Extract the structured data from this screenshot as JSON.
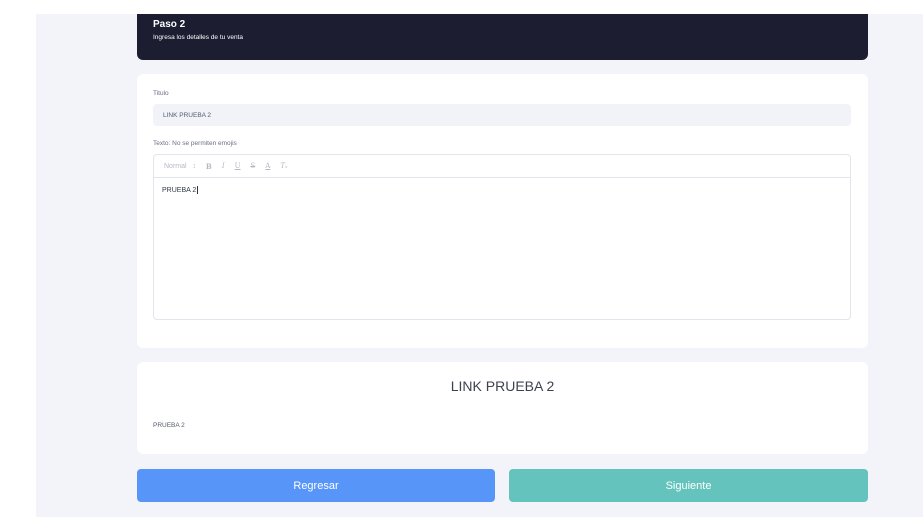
{
  "header": {
    "step": "Paso 2",
    "subtitle": "Ingresa los detalles de tu venta"
  },
  "form": {
    "title_label": "Titulo",
    "title_value": "LINK PRUEBA 2",
    "text_label": "Texto: No se permiten emojis",
    "toolbar": {
      "format": "Normal",
      "format_arrow": "↕",
      "bold": "B",
      "italic": "I",
      "underline": "U",
      "strike": "S",
      "color": "A",
      "clear": "Tₓ"
    },
    "editor_text": "PRUEBA 2"
  },
  "preview": {
    "title": "LINK PRUEBA 2",
    "body": "PRUEBA 2"
  },
  "buttons": {
    "back": "Regresar",
    "next": "Siguiente"
  },
  "colors": {
    "header_bg": "#1c1d31",
    "back_button": "#5795f8",
    "next_button": "#64c4bd"
  }
}
